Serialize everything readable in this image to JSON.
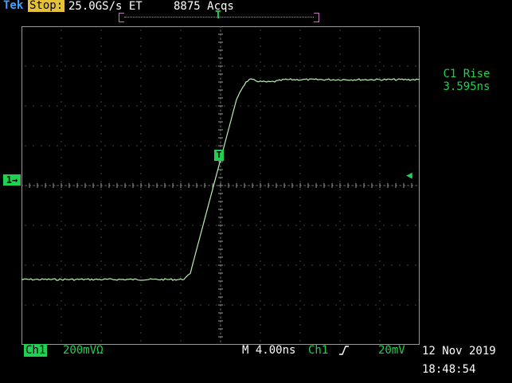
{
  "header": {
    "brand": "Tek",
    "state": "Stop:",
    "sample_rate": "25.0GS/s ET",
    "acquisitions": "8875 Acqs",
    "trigger_bar_marker": "T"
  },
  "markers": {
    "ch1_ground": "1→",
    "trigger_level": "◀",
    "trigger_point": "T"
  },
  "measurement": {
    "label": "C1 Rise",
    "value": "3.595ns"
  },
  "footer": {
    "channel": "Ch1",
    "channel_scale": "200mVΩ",
    "timebase": "M 4.00ns",
    "trigger_source": "Ch1",
    "trigger_slope_icon": "rising-edge-icon",
    "trigger_level": "20mV",
    "date": "12 Nov 2019",
    "time": "18:48:54"
  },
  "colors": {
    "background": "#000000",
    "trace": "#b8f0b0",
    "channel": "#20d050",
    "graticule": "#9a9a9a",
    "brand": "#3fa0ff",
    "stop_badge": "#e3c23a"
  }
}
